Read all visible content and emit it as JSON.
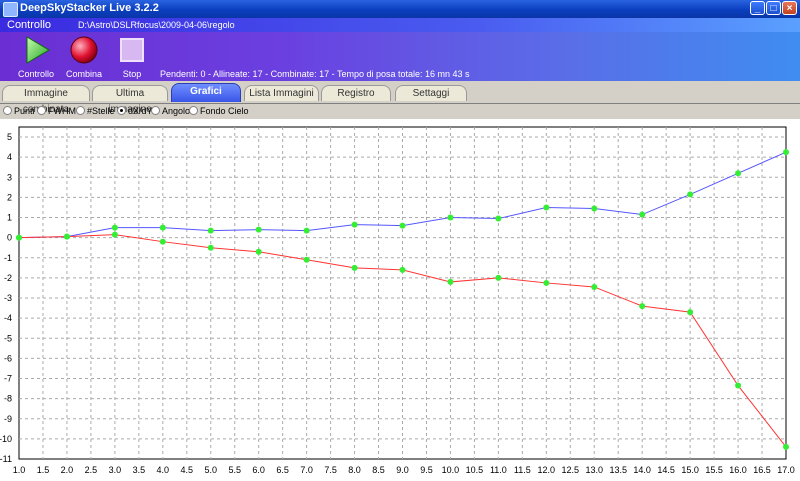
{
  "window": {
    "title": "DeepSkyStacker Live 3.2.2",
    "minimize": "_",
    "maximize": "□",
    "close": "×"
  },
  "control": {
    "header_label": "Controllo",
    "path": "D:\\Astro\\DSLRfocus\\2009-04-06\\regolo",
    "buttons": [
      {
        "label": "Controllo",
        "icon": "play-icon"
      },
      {
        "label": "Combina",
        "icon": "record-icon"
      },
      {
        "label": "Stop",
        "icon": "stop-icon"
      }
    ],
    "status": "Pendenti: 0 - Allineate: 17 - Combinate: 17 - Tempo di posa totale: 16 mn 43 s"
  },
  "tabs": [
    {
      "label": "Immagine combinata",
      "active": false
    },
    {
      "label": "Ultima immagine",
      "active": false
    },
    {
      "label": "Grafici",
      "active": true
    },
    {
      "label": "Lista Immagini",
      "active": false
    },
    {
      "label": "Registro",
      "active": false
    },
    {
      "label": "Settaggi",
      "active": false
    }
  ],
  "graph_options": [
    {
      "label": "Punti",
      "checked": false
    },
    {
      "label": "FWHM",
      "checked": false
    },
    {
      "label": "#Stelle",
      "checked": false
    },
    {
      "label": "dX/dY",
      "checked": true
    },
    {
      "label": "Angolo",
      "checked": false
    },
    {
      "label": "Fondo Cielo",
      "checked": false
    }
  ],
  "chart_data": {
    "type": "line",
    "xlim": [
      1.0,
      17.0
    ],
    "ylim": [
      -11,
      5.5
    ],
    "x_ticks": [
      "1.0",
      "1.5",
      "2.0",
      "2.5",
      "3.0",
      "3.5",
      "4.0",
      "4.5",
      "5.0",
      "5.5",
      "6.0",
      "6.5",
      "7.0",
      "7.5",
      "8.0",
      "8.5",
      "9.0",
      "9.5",
      "10.0",
      "10.5",
      "11.0",
      "11.5",
      "12.0",
      "12.5",
      "13.0",
      "13.5",
      "14.0",
      "14.5",
      "15.0",
      "15.5",
      "16.0",
      "16.5",
      "17.0"
    ],
    "y_ticks": [
      "5",
      "4",
      "3",
      "2",
      "1",
      "0",
      "-1",
      "-2",
      "-3",
      "-4",
      "-5",
      "-6",
      "-7",
      "-8",
      "-9",
      "-10",
      "-11"
    ],
    "grid": true,
    "marker_color": "#33ee33",
    "series": [
      {
        "color": "#5555ff",
        "x": [
          1,
          2,
          3,
          4,
          5,
          6,
          7,
          8,
          9,
          10,
          11,
          12,
          13,
          14,
          15,
          16,
          17
        ],
        "y": [
          0,
          0.05,
          0.5,
          0.5,
          0.35,
          0.4,
          0.35,
          0.65,
          0.6,
          1.0,
          0.95,
          1.5,
          1.45,
          1.15,
          2.15,
          3.2,
          4.25
        ]
      },
      {
        "color": "#ff3333",
        "x": [
          1,
          2,
          3,
          4,
          5,
          6,
          7,
          8,
          9,
          10,
          11,
          12,
          13,
          14,
          15,
          16,
          17
        ],
        "y": [
          0,
          0.05,
          0.15,
          -0.2,
          -0.5,
          -0.7,
          -1.1,
          -1.5,
          -1.6,
          -2.2,
          -2.0,
          -2.25,
          -2.45,
          -3.4,
          -3.7,
          -7.35,
          -10.4
        ]
      }
    ]
  }
}
